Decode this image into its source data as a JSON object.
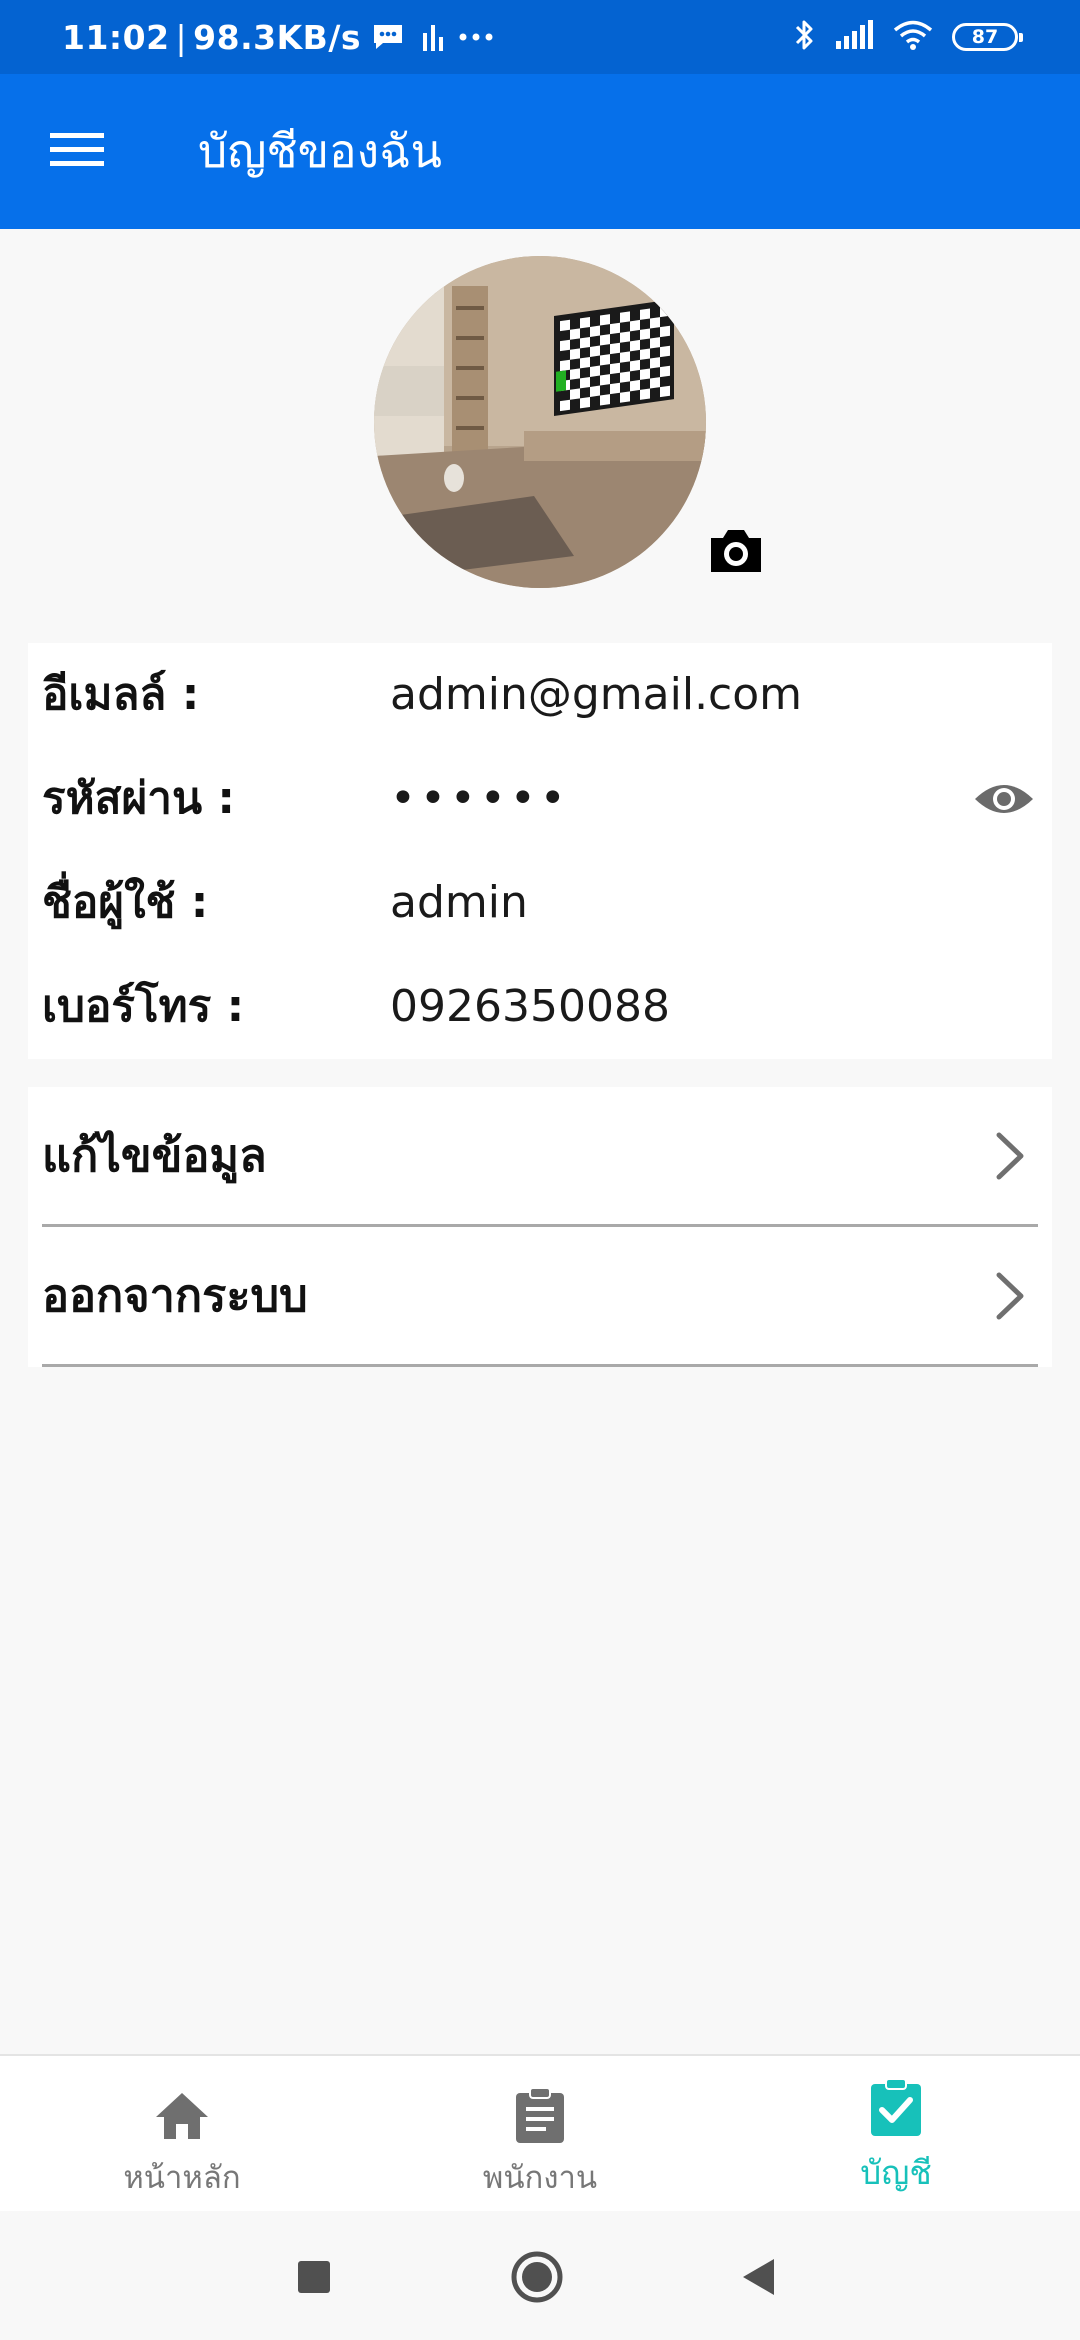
{
  "status_bar": {
    "time": "11:02",
    "separator": "|",
    "network_speed": "98.3KB/s",
    "battery_level": "87",
    "icons": [
      "message-icon",
      "equalizer-icon",
      "more-dots-icon",
      "bluetooth-icon",
      "signal-icon",
      "wifi-icon"
    ]
  },
  "app_bar": {
    "title": "บัญชีของฉัน",
    "menu_icon": "hamburger-menu-icon"
  },
  "profile": {
    "avatar_icon": "profile-photo",
    "camera_icon": "camera-icon"
  },
  "info": {
    "email": {
      "label": "อีเมลล์ :",
      "value": "admin@gmail.com"
    },
    "password": {
      "label": "รหัสผ่าน :",
      "value": "••••••",
      "toggle_icon": "eye-icon"
    },
    "username": {
      "label": "ชื่อผู้ใช้ :",
      "value": "admin"
    },
    "phone": {
      "label": "เบอร์โทร :",
      "value": "0926350088"
    }
  },
  "actions": {
    "edit": {
      "label": "แก้ไขข้อมูล",
      "icon": "chevron-right-icon"
    },
    "logout": {
      "label": "ออกจากระบบ",
      "icon": "chevron-right-icon"
    }
  },
  "bottom_nav": {
    "items": [
      {
        "label": "หน้าหลัก",
        "icon": "home-icon",
        "active": false
      },
      {
        "label": "พนักงาน",
        "icon": "clipboard-list-icon",
        "active": false
      },
      {
        "label": "บัญชี",
        "icon": "clipboard-check-icon",
        "active": true
      }
    ]
  },
  "system_nav": {
    "icons": [
      "recent-apps-icon",
      "home-circle-icon",
      "back-icon"
    ]
  },
  "colors": {
    "status_bar": "#0463d1",
    "app_bar": "#0670ea",
    "background": "#f8f8f8",
    "active_tab": "#17c1ba",
    "inactive_tab": "#777777",
    "divider": "#a9a9a9"
  }
}
